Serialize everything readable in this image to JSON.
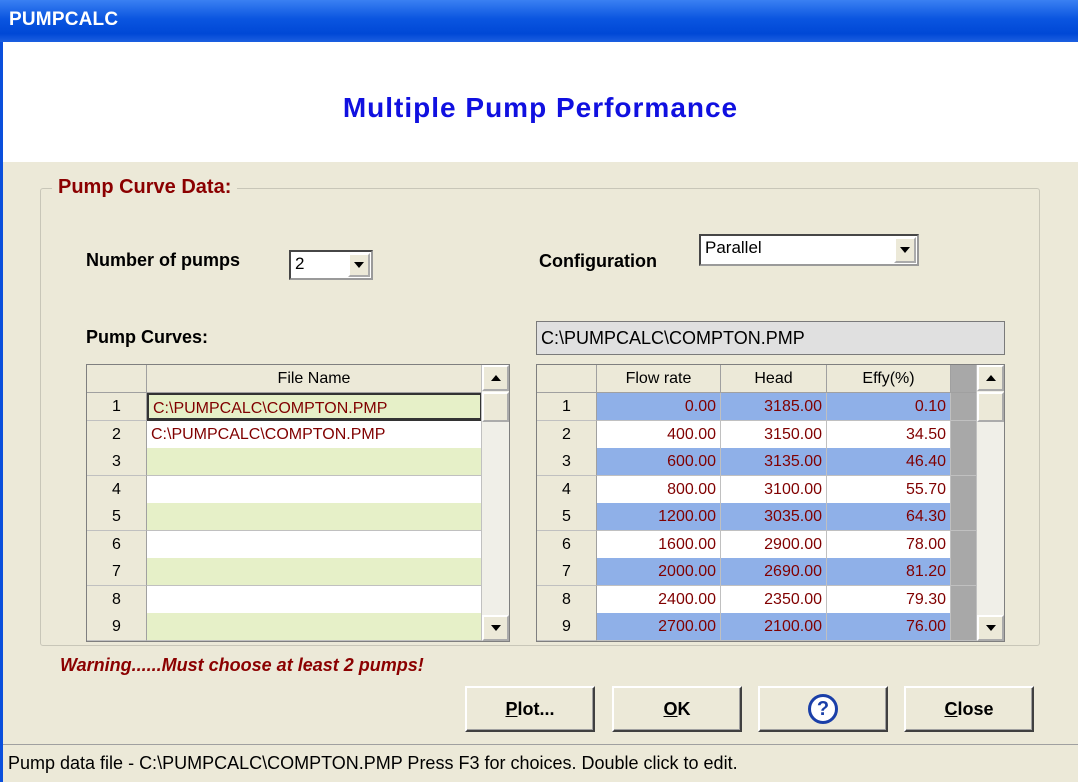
{
  "window": {
    "title": "PUMPCALC"
  },
  "header": {
    "title": "Multiple Pump Performance"
  },
  "group": {
    "title": "Pump Curve Data:"
  },
  "pumps": {
    "label": "Number of pumps",
    "value": "2"
  },
  "configuration": {
    "label": "Configuration",
    "value": "Parallel"
  },
  "curves": {
    "label": "Pump Curves:"
  },
  "current_file": "C:\\PUMPCALC\\COMPTON.PMP",
  "file_grid": {
    "header": "File Name",
    "rows": [
      {
        "num": "1",
        "name": "C:\\PUMPCALC\\COMPTON.PMP"
      },
      {
        "num": "2",
        "name": "C:\\PUMPCALC\\COMPTON.PMP"
      },
      {
        "num": "3",
        "name": ""
      },
      {
        "num": "4",
        "name": ""
      },
      {
        "num": "5",
        "name": ""
      },
      {
        "num": "6",
        "name": ""
      },
      {
        "num": "7",
        "name": ""
      },
      {
        "num": "8",
        "name": ""
      },
      {
        "num": "9",
        "name": ""
      }
    ]
  },
  "data_grid": {
    "headers": [
      "Flow rate",
      "Head",
      "Effy(%)"
    ],
    "rows": [
      {
        "num": "1",
        "flow": "0.00",
        "head": "3185.00",
        "effy": "0.10"
      },
      {
        "num": "2",
        "flow": "400.00",
        "head": "3150.00",
        "effy": "34.50"
      },
      {
        "num": "3",
        "flow": "600.00",
        "head": "3135.00",
        "effy": "46.40"
      },
      {
        "num": "4",
        "flow": "800.00",
        "head": "3100.00",
        "effy": "55.70"
      },
      {
        "num": "5",
        "flow": "1200.00",
        "head": "3035.00",
        "effy": "64.30"
      },
      {
        "num": "6",
        "flow": "1600.00",
        "head": "2900.00",
        "effy": "78.00"
      },
      {
        "num": "7",
        "flow": "2000.00",
        "head": "2690.00",
        "effy": "81.20"
      },
      {
        "num": "8",
        "flow": "2400.00",
        "head": "2350.00",
        "effy": "79.30"
      },
      {
        "num": "9",
        "flow": "2700.00",
        "head": "2100.00",
        "effy": "76.00"
      }
    ]
  },
  "warning": "Warning......Must choose at least 2 pumps!",
  "buttons": {
    "plot_first": "P",
    "plot_rest": "lot...",
    "ok_first": "O",
    "ok_rest": "K",
    "help": "?",
    "close_first": "C",
    "close_rest": "lose"
  },
  "status": "Pump data file  - C:\\PUMPCALC\\COMPTON.PMP     Press F3 for choices.  Double click to edit."
}
